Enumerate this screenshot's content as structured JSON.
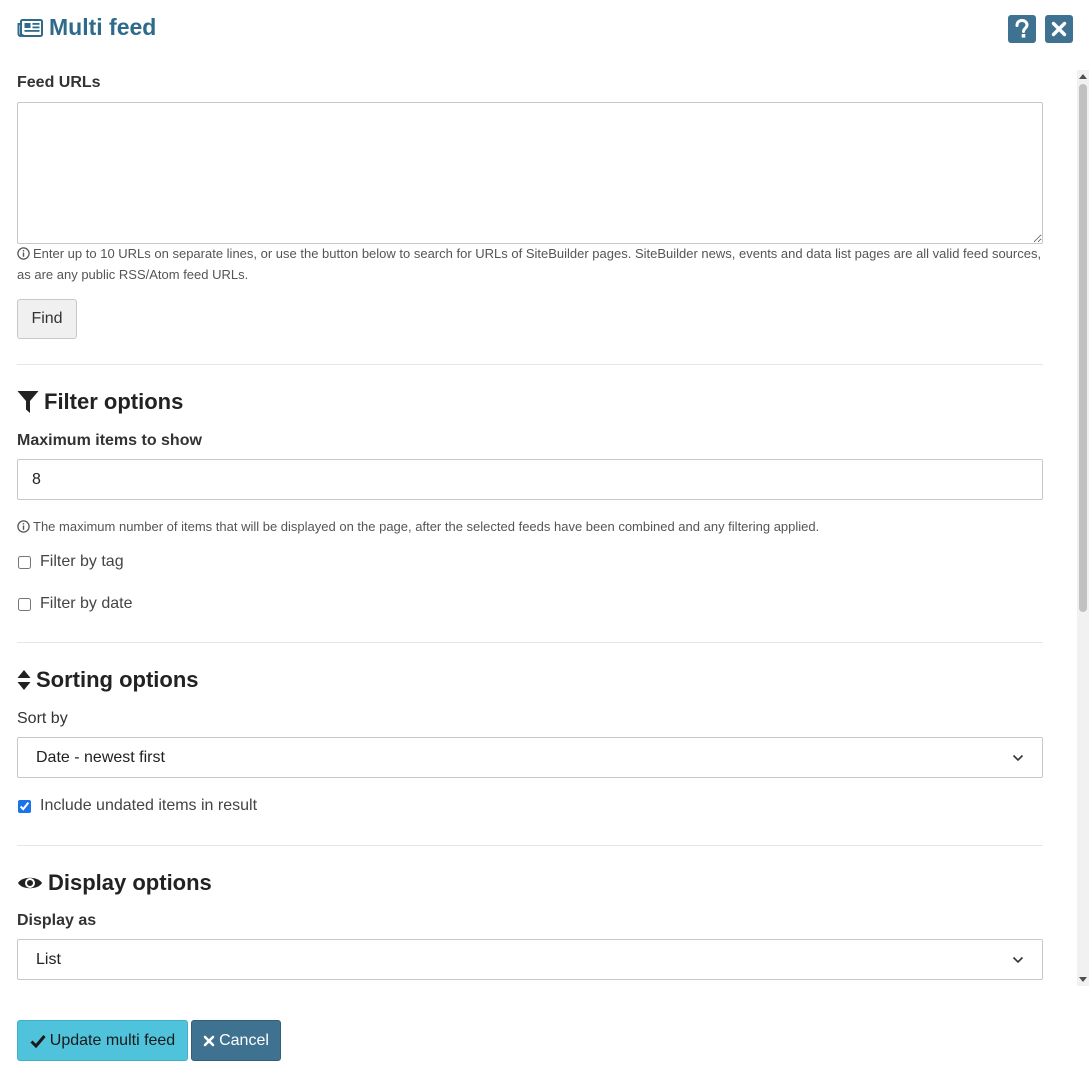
{
  "header": {
    "title": "Multi feed",
    "help_label": "?",
    "close_label": "×"
  },
  "feed_urls": {
    "label": "Feed URLs",
    "value": "",
    "help": "Enter up to 10 URLs on separate lines, or use the button below to search for URLs of SiteBuilder pages. SiteBuilder news, events and data list pages are all valid feed sources, as are any public RSS/Atom feed URLs.",
    "find_label": "Find"
  },
  "filter_options": {
    "title": "Filter options",
    "max_items_label": "Maximum items to show",
    "max_items_value": "8",
    "max_items_help": "The maximum number of items that will be displayed on the page, after the selected feeds have been combined and any filtering applied.",
    "filter_by_tag": {
      "label": "Filter by tag",
      "checked": false
    },
    "filter_by_date": {
      "label": "Filter by date",
      "checked": false
    }
  },
  "sorting_options": {
    "title": "Sorting options",
    "sort_by_label": "Sort by",
    "sort_by_value": "Date - newest first",
    "include_undated": {
      "label": "Include undated items in result",
      "checked": true
    }
  },
  "display_options": {
    "title": "Display options",
    "display_as_label": "Display as",
    "display_as_value": "List"
  },
  "footer": {
    "update_label": "Update multi feed",
    "cancel_label": "Cancel"
  },
  "colors": {
    "title": "#2e6a8a",
    "header_button": "#3f7290",
    "primary": "#4fc3db",
    "checkbox_accent": "#1a73e8"
  },
  "icons": {
    "title": "newspaper-icon",
    "filter": "filter-icon",
    "sort": "sort-icon",
    "display": "eye-icon",
    "update": "check-icon",
    "cancel": "close-icon",
    "info": "info-icon"
  }
}
